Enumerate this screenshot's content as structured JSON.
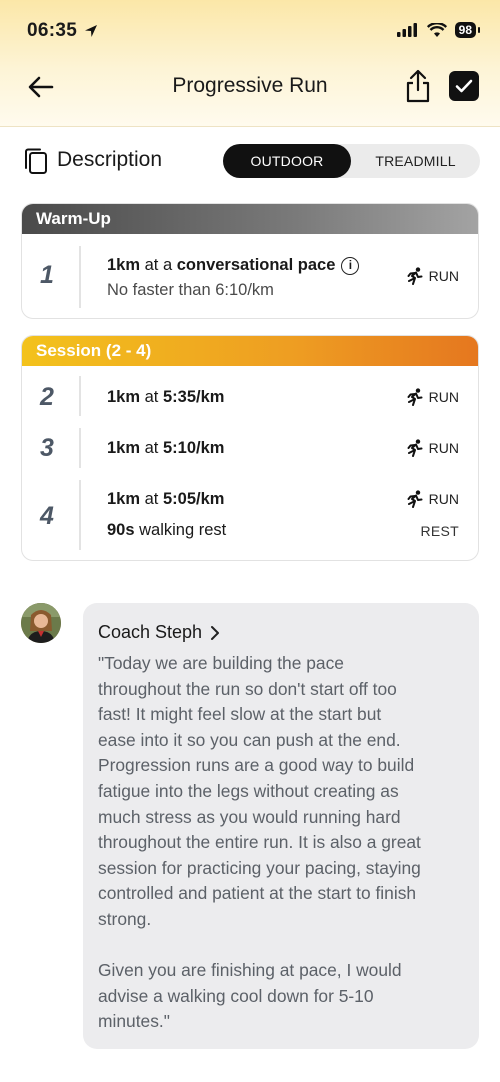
{
  "status_bar": {
    "time": "06:35",
    "battery": "98"
  },
  "header": {
    "title": "Progressive Run"
  },
  "description": {
    "label": "Description",
    "segments": [
      "OUTDOOR",
      "TREADMILL"
    ],
    "selected": "OUTDOOR"
  },
  "warmup": {
    "title": "Warm-Up",
    "steps": [
      {
        "number": "1",
        "distance": "1km",
        "connector": " at a ",
        "pace": "conversational pace",
        "sub": "No faster than 6:10/km",
        "tag": "RUN"
      }
    ]
  },
  "session": {
    "title": "Session (2 - 4)",
    "steps": [
      {
        "number": "2",
        "distance": "1km",
        "connector": " at ",
        "pace": "5:35/km",
        "tag": "RUN"
      },
      {
        "number": "3",
        "distance": "1km",
        "connector": " at ",
        "pace": "5:10/km",
        "tag": "RUN"
      },
      {
        "number": "4",
        "distance": "1km",
        "connector": " at ",
        "pace": "5:05/km",
        "tag": "RUN",
        "rest_amount": "90s",
        "rest_text": " walking rest",
        "rest_tag": "REST"
      }
    ]
  },
  "coach": {
    "name": "Coach Steph",
    "message": "\"Today we are building the pace\nthroughout the run so don't start off too\nfast! It might feel slow at the start but\nease into it so you can push at the end.\nProgression runs are a good way to build\nfatigue into the legs without creating as\nmuch stress as you would running hard\nthroughout the entire run. It is also a great\nsession for practicing your pacing, staying\ncontrolled and patient at the start to finish\nstrong.\n\nGiven you are finishing at pace, I would\nadvise a walking cool down for 5-10\nminutes.\""
  },
  "colors": {
    "header_bg": "#fbe7a8",
    "warmup_header": "#4a4a4a",
    "session_header_start": "#f3c21c",
    "session_header_end": "#e5771f",
    "selected_segment": "#111111",
    "bubble_bg": "#ececee"
  }
}
